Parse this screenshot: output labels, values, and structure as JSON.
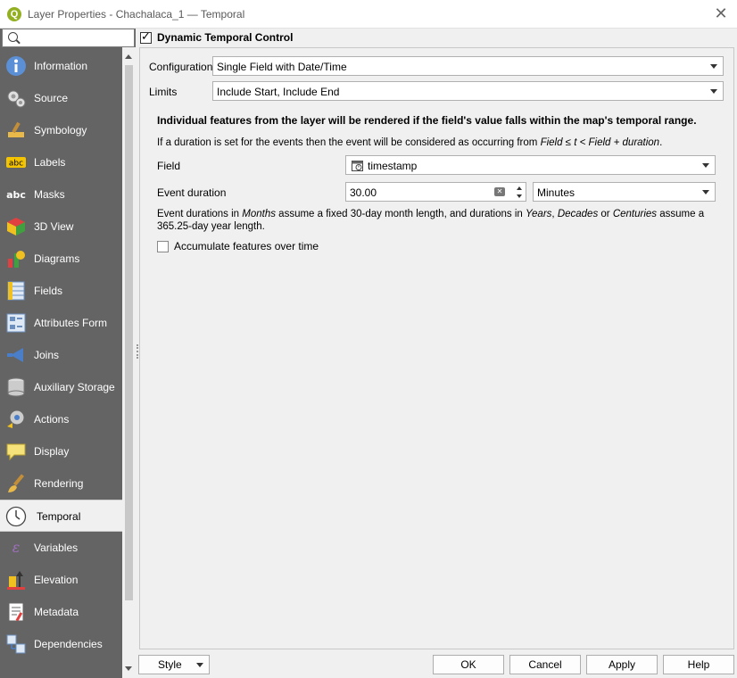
{
  "window": {
    "app_icon": "qgis-icon",
    "title": "Layer Properties - Chachalaca_1 — Temporal",
    "close_label": "✕"
  },
  "sidebar": {
    "search_placeholder": "",
    "items": [
      {
        "label": "Information",
        "icon": "information-icon"
      },
      {
        "label": "Source",
        "icon": "source-icon"
      },
      {
        "label": "Symbology",
        "icon": "symbology-icon"
      },
      {
        "label": "Labels",
        "icon": "labels-icon"
      },
      {
        "label": "Masks",
        "icon": "masks-icon"
      },
      {
        "label": "3D View",
        "icon": "3d-view-icon"
      },
      {
        "label": "Diagrams",
        "icon": "diagrams-icon"
      },
      {
        "label": "Fields",
        "icon": "fields-icon"
      },
      {
        "label": "Attributes Form",
        "icon": "attributes-form-icon"
      },
      {
        "label": "Joins",
        "icon": "joins-icon"
      },
      {
        "label": "Auxiliary Storage",
        "icon": "auxiliary-storage-icon"
      },
      {
        "label": "Actions",
        "icon": "actions-icon"
      },
      {
        "label": "Display",
        "icon": "display-icon"
      },
      {
        "label": "Rendering",
        "icon": "rendering-icon"
      },
      {
        "label": "Temporal",
        "icon": "temporal-icon",
        "selected": true
      },
      {
        "label": "Variables",
        "icon": "variables-icon"
      },
      {
        "label": "Elevation",
        "icon": "elevation-icon"
      },
      {
        "label": "Metadata",
        "icon": "metadata-icon"
      },
      {
        "label": "Dependencies",
        "icon": "dependencies-icon"
      }
    ]
  },
  "temporal": {
    "dynamic_control_label": "Dynamic Temporal Control",
    "dynamic_control_checked": true,
    "configuration_label": "Configuration",
    "configuration_value": "Single Field with Date/Time",
    "limits_label": "Limits",
    "limits_value": "Include Start, Include End",
    "info_bold": "Individual features from the layer will be rendered if the field's value falls within the map's temporal range.",
    "duration_info_prefix": "If a duration is set for the events then the event will be considered as occurring from ",
    "duration_info_formula": "Field ≤ t < Field + duration",
    "duration_info_suffix": ".",
    "field_label": "Field",
    "field_value": "timestamp",
    "field_icon": "datetime-field-icon",
    "event_duration_label": "Event duration",
    "event_duration_value": "30.00",
    "duration_unit": "Minutes",
    "note_1": "Event durations in ",
    "note_months": "Months",
    "note_2": " assume a fixed 30-day month length, and durations in ",
    "note_years": "Years",
    "note_3": ", ",
    "note_decades": "Decades",
    "note_4": " or ",
    "note_centuries": "Centuries",
    "note_5": " assume a 365.25-day year length.",
    "accumulate_label": "Accumulate features over time",
    "accumulate_checked": false
  },
  "buttons": {
    "style": "Style",
    "ok": "OK",
    "cancel": "Cancel",
    "apply": "Apply",
    "help": "Help"
  }
}
